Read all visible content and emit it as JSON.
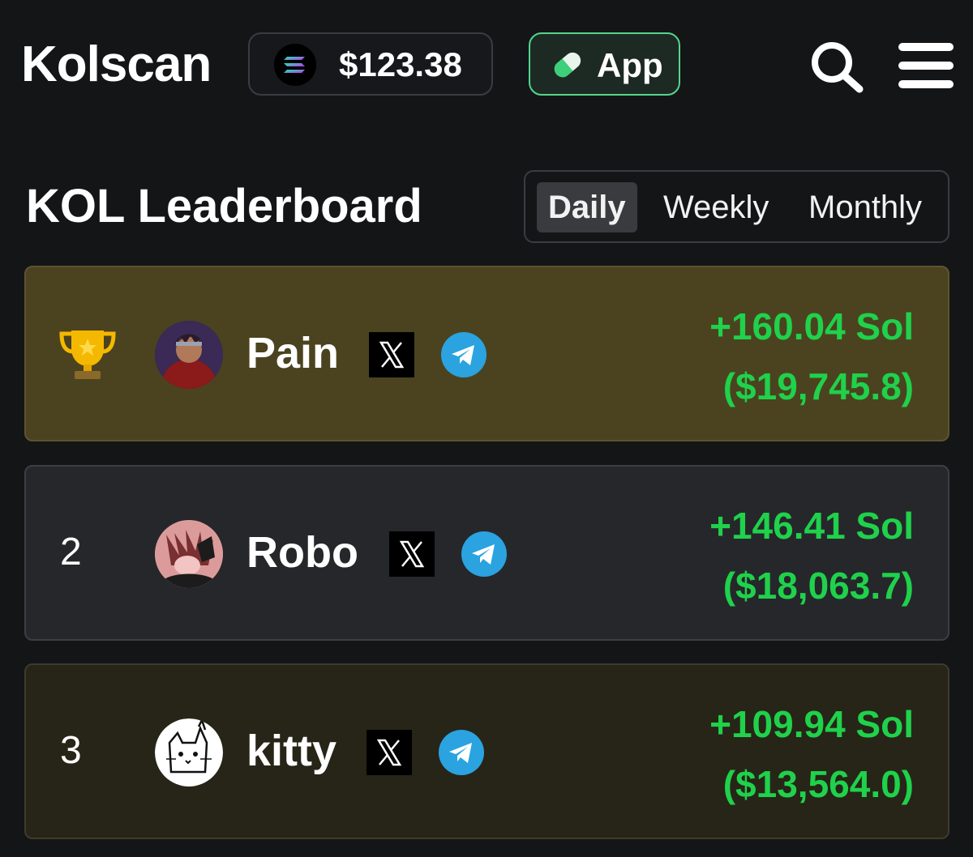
{
  "header": {
    "logo": "Kolscan",
    "sol_price": "$123.38",
    "app_label": "App",
    "icons": [
      "solana-logo-icon",
      "pill-icon",
      "search-icon",
      "menu-icon"
    ],
    "app_border_color": "#53d68e"
  },
  "page_title": "KOL Leaderboard",
  "tabs": [
    {
      "label": "Daily",
      "active": true
    },
    {
      "label": "Weekly",
      "active": false
    },
    {
      "label": "Monthly",
      "active": false
    }
  ],
  "leaderboard": [
    {
      "rank": "1",
      "rank_icon": "trophy-icon",
      "name": "Pain",
      "sol": "+160.04 Sol",
      "usd": "($19,745.8)"
    },
    {
      "rank": "2",
      "name": "Robo",
      "sol": "+146.41 Sol",
      "usd": "($18,063.7)"
    },
    {
      "rank": "3",
      "name": "kitty",
      "sol": "+109.94 Sol",
      "usd": "($13,564.0)"
    }
  ],
  "colors": {
    "background": "#141517",
    "profit_green": "#1fd14b",
    "first_place_row": "#4b431f",
    "third_place_row": "#272517",
    "telegram_blue": "#2aa3e0"
  }
}
